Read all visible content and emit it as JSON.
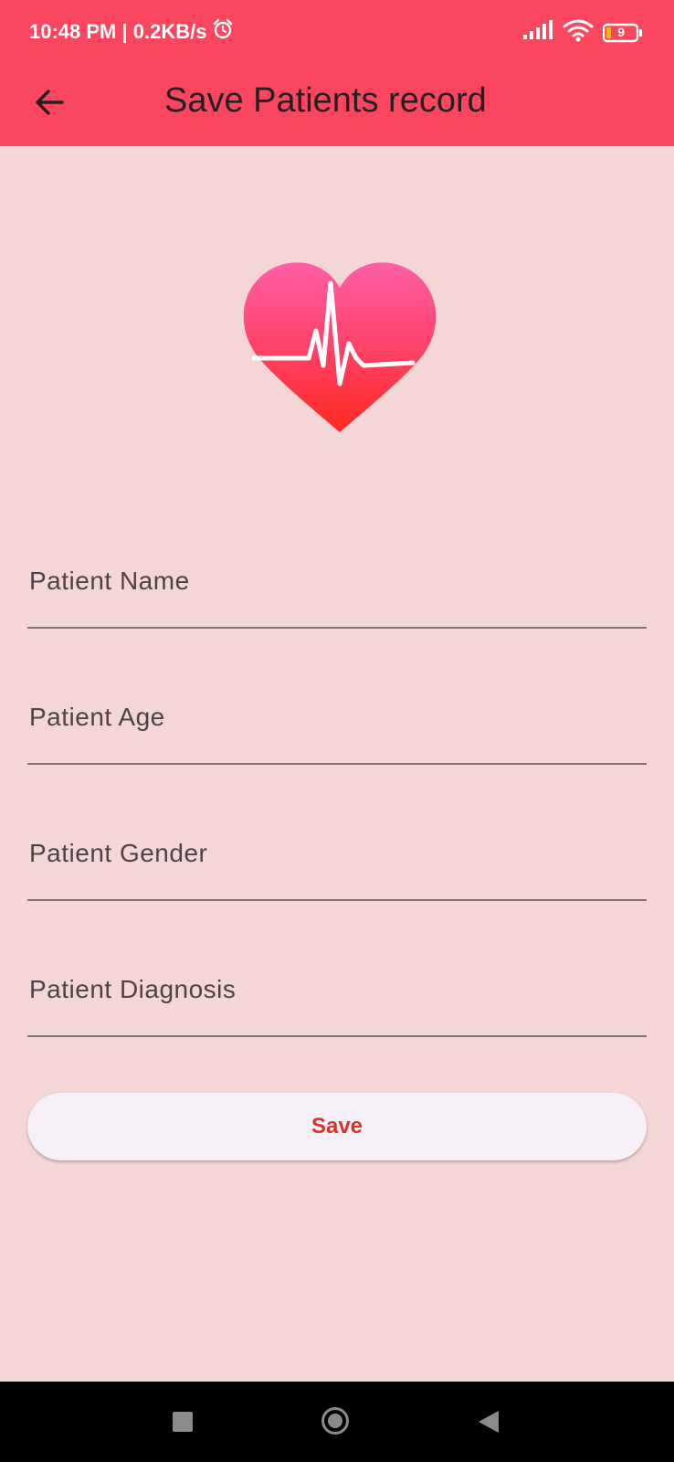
{
  "status_bar": {
    "time_speed": "10:48 PM | 0.2KB/s",
    "battery_level": "9",
    "icons": [
      "alarm-icon",
      "signal-icon",
      "wifi-icon",
      "battery-icon"
    ]
  },
  "app_bar": {
    "title": "Save Patients record",
    "back_icon": "arrow-back-icon",
    "background": "#fa465f"
  },
  "logo": {
    "icon": "heartbeat-heart-icon"
  },
  "form": {
    "fields": [
      {
        "label": "Patient Name",
        "value": ""
      },
      {
        "label": "Patient Age",
        "value": ""
      },
      {
        "label": "Patient Gender",
        "value": ""
      },
      {
        "label": "Patient Diagnosis",
        "value": ""
      }
    ],
    "save_label": "Save",
    "save_color": "#d9342b"
  },
  "nav_bar": {
    "icons": [
      "recent-apps-icon",
      "home-icon",
      "back-icon"
    ]
  }
}
